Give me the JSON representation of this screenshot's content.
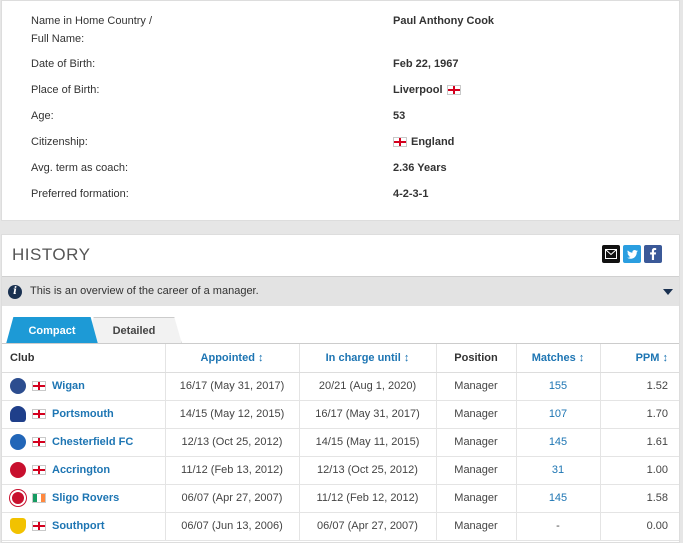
{
  "profile": {
    "name_label": "Name in Home Country /",
    "name_label2": "Full Name:",
    "name_value": "Paul Anthony Cook",
    "dob_label": "Date of Birth:",
    "dob_value": "Feb 22, 1967",
    "pob_label": "Place of Birth:",
    "pob_value": "Liverpool",
    "age_label": "Age:",
    "age_value": "53",
    "citizenship_label": "Citizenship:",
    "citizenship_value": "England",
    "term_label": "Avg. term as coach:",
    "term_value": "2.36 Years",
    "formation_label": "Preferred formation:",
    "formation_value": "4-2-3-1"
  },
  "history": {
    "title": "HISTORY",
    "notice": "This is an overview of the career of a manager.",
    "tabs": {
      "compact": "Compact",
      "detailed": "Detailed"
    },
    "columns": {
      "club": "Club",
      "appointed": "Appointed ↕",
      "in_charge_until": "In charge until ↕",
      "position": "Position",
      "matches": "Matches ↕",
      "ppm": "PPM ↕"
    },
    "rows": [
      {
        "club": "Wigan",
        "appointed": "16/17 (May 31, 2017)",
        "until": "20/21 (Aug 1, 2020)",
        "position": "Manager",
        "matches": "155",
        "ppm": "1.52"
      },
      {
        "club": "Portsmouth",
        "appointed": "14/15 (May 12, 2015)",
        "until": "16/17 (May 31, 2017)",
        "position": "Manager",
        "matches": "107",
        "ppm": "1.70"
      },
      {
        "club": "Chesterfield FC",
        "appointed": "12/13 (Oct 25, 2012)",
        "until": "14/15 (May 11, 2015)",
        "position": "Manager",
        "matches": "145",
        "ppm": "1.61"
      },
      {
        "club": "Accrington",
        "appointed": "11/12 (Feb 13, 2012)",
        "until": "12/13 (Oct 25, 2012)",
        "position": "Manager",
        "matches": "31",
        "ppm": "1.00"
      },
      {
        "club": "Sligo Rovers",
        "appointed": "06/07 (Apr 27, 2007)",
        "until": "11/12 (Feb 12, 2012)",
        "position": "Manager",
        "matches": "145",
        "ppm": "1.58"
      },
      {
        "club": "Southport",
        "appointed": "06/07 (Jun 13, 2006)",
        "until": "06/07 (Apr 27, 2007)",
        "position": "Manager",
        "matches": "-",
        "ppm": "0.00"
      }
    ]
  },
  "icons": {
    "email": "email-icon",
    "twitter": "twitter-icon",
    "facebook": "facebook-icon",
    "info": "info-icon",
    "caret": "chevron-down-icon"
  },
  "colors": {
    "accent": "#1d9ad6",
    "link": "#1d75b3",
    "navy": "#1a3151"
  }
}
